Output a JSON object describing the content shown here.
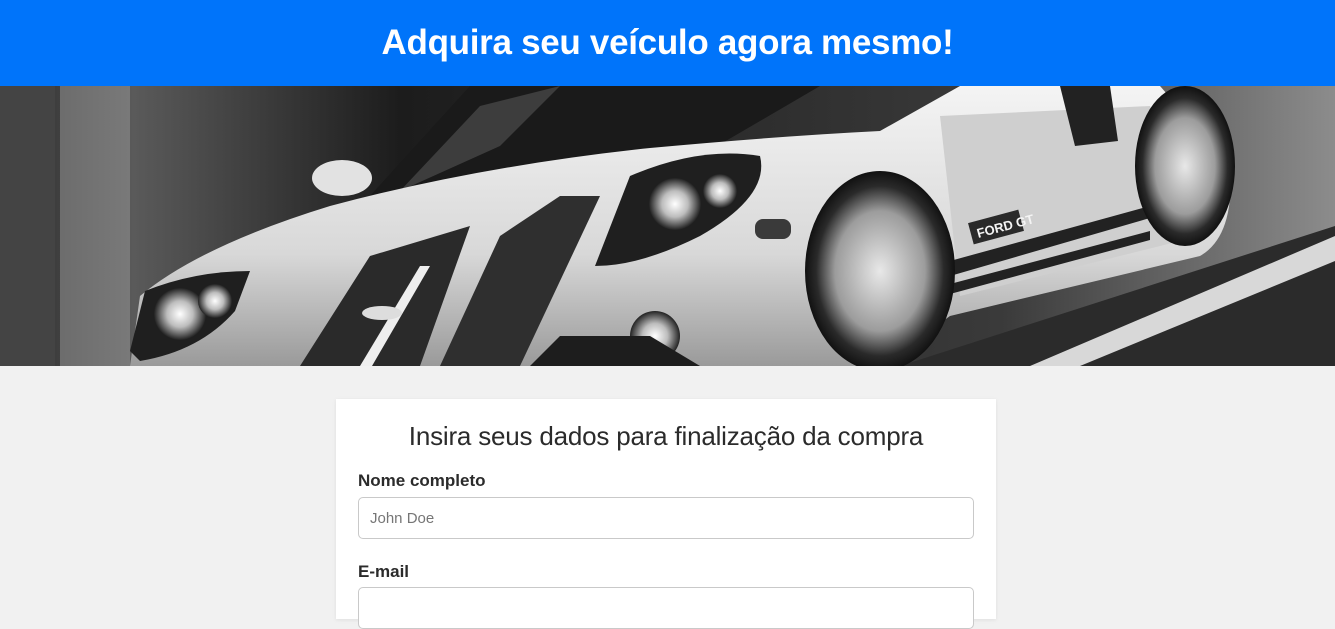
{
  "header": {
    "title": "Adquira seu veículo agora mesmo!",
    "background_color": "#0074fa"
  },
  "hero": {
    "image_description_icon": "car-photo",
    "badge_text": "FORD GT"
  },
  "form": {
    "title": "Insira seus dados para finalização da compra",
    "fields": [
      {
        "label": "Nome completo",
        "placeholder": "John Doe"
      },
      {
        "label": "E-mail",
        "placeholder": ""
      }
    ]
  }
}
